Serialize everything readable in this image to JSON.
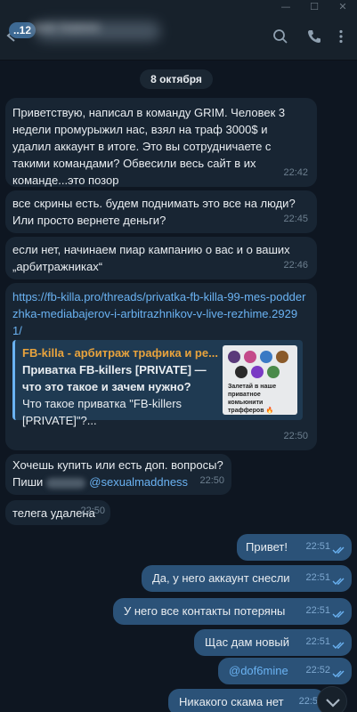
{
  "window": {
    "minimize": "—",
    "maximize": "☐",
    "close": "✕"
  },
  "header": {
    "unread_count": "12",
    "chat_title": "Ivan Ivanov",
    "icons": [
      "back-arrow-icon",
      "search-icon",
      "phone-icon",
      "more-icon"
    ]
  },
  "chat": {
    "date": "8 октября",
    "messages": [
      {
        "dir": "in",
        "text": "Приветствую, написал в команду GRIM. Человек 3 недели промурыжил нас, взял на траф 3000$ и удалил аккаунт в итоге. Это вы сотрудничаете с такими командами? Обвесили весь сайт в их команде...это позор",
        "time": "22:42"
      },
      {
        "dir": "in",
        "text": "все скрины есть. будем поднимать это все на люди? Или просто вернете деньги?",
        "time": "22:45"
      },
      {
        "dir": "in",
        "text": "если нет, начинаем пиар кампанию о вас и о ваших „арбитражниках“",
        "time": "22:46"
      },
      {
        "dir": "in",
        "link": "https://fb-killa.pro/threads/privatka-fb-killa-99-mes-podderzhka-mediabajerov-i-arbitrazhnikov-v-live-rezhime.29291/",
        "time": "22:50",
        "preview": {
          "site": "FB-killa - арбитраж трафика и ре...",
          "title": "Приватка FB-killers [PRIVATE] — что это такое и зачем нужно?",
          "description": "Что такое приватка \"FB-killers [PRIVATE]\"?...",
          "thumb_text": "Залетай в наше приватное комьюнити трафферов 🔥"
        }
      },
      {
        "dir": "in",
        "text_a": "Хочешь купить или есть доп. вопросы?",
        "text_b": "Пиши",
        "mention": "@sexualmaddness",
        "time": "22:50"
      },
      {
        "dir": "in",
        "text": "телега удалена",
        "time": "22:50"
      },
      {
        "dir": "out",
        "text": "Привет!",
        "time": "22:51"
      },
      {
        "dir": "out",
        "text": "Да, у него аккаунт снесли",
        "time": "22:51"
      },
      {
        "dir": "out",
        "text": "У него все контакты потеряны",
        "time": "22:51"
      },
      {
        "dir": "out",
        "text": "Щас дам новый",
        "time": "22:51"
      },
      {
        "dir": "out",
        "text": "@dof6mine",
        "time": "22:52"
      },
      {
        "dir": "out",
        "text": "Никакого скама нет",
        "time": "22:5"
      }
    ]
  },
  "colors": {
    "background": "#0e1621",
    "incoming_bubble": "#182533",
    "outgoing_bubble": "#2b5278",
    "link": "#6ab2f2",
    "preview_site": "#e8a33d"
  }
}
